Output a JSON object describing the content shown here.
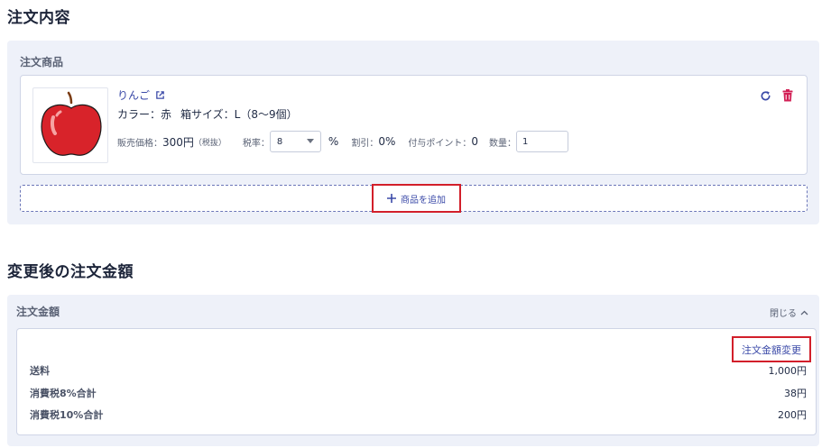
{
  "order_contents": {
    "title": "注文内容",
    "products_label": "注文商品",
    "product": {
      "name": "りんご",
      "color_attr": "カラー：赤",
      "box_attr": "箱サイズ：L（8〜9個）",
      "price_label": "販売価格：",
      "price_value": "300円",
      "price_note": "（税抜）",
      "tax_label": "税率：",
      "tax_value": "8",
      "tax_unit": "%",
      "discount_label": "割引：",
      "discount_value": "0%",
      "points_label": "付与ポイント：",
      "points_value": "0",
      "qty_label": "数量：",
      "qty_value": "1"
    },
    "add_button_label": "商品を追加"
  },
  "order_amount": {
    "title": "変更後の注文金額",
    "panel_label": "注文金額",
    "collapse_label": "閉じる",
    "change_button_label": "注文金額変更",
    "rows": [
      {
        "label": "送料",
        "value": "1,000円"
      },
      {
        "label": "消費税8%合計",
        "value": "38円"
      },
      {
        "label": "消費税10%合計",
        "value": "200円"
      }
    ]
  },
  "colors": {
    "accent": "#3b4aa8",
    "danger": "#d21f2a",
    "panel_bg": "#eef1f9"
  }
}
